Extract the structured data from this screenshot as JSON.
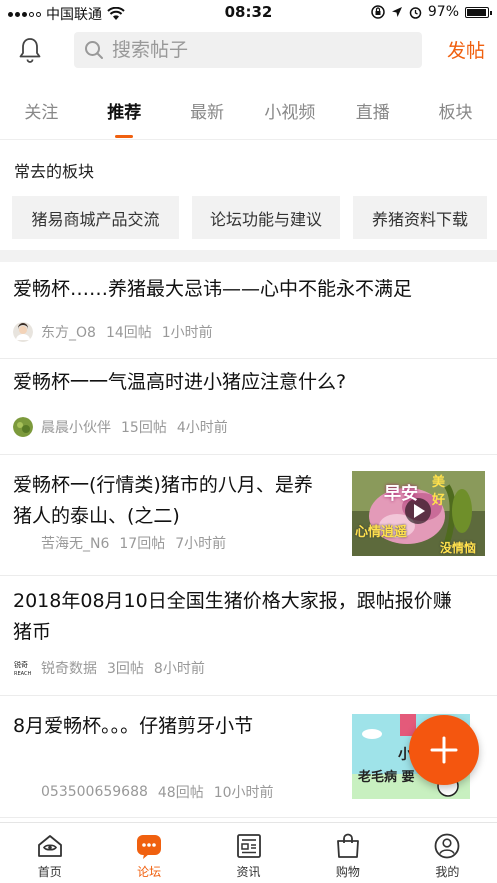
{
  "status_bar": {
    "carrier": "中国联通",
    "time": "08:32",
    "battery": "97%",
    "battery_level": 0.97
  },
  "header": {
    "search_placeholder": "搜索帖子",
    "post_button": "发帖",
    "icons": [
      "bell-icon",
      "search-icon"
    ]
  },
  "tabs": [
    {
      "label": "关注",
      "active": false
    },
    {
      "label": "推荐",
      "active": true
    },
    {
      "label": "最新",
      "active": false
    },
    {
      "label": "小视频",
      "active": false
    },
    {
      "label": "直播",
      "active": false
    },
    {
      "label": "板块",
      "active": false
    }
  ],
  "frequent": {
    "title": "常去的板块",
    "boards": [
      "猪易商城产品交流",
      "论坛功能与建议",
      "养猪资料下载"
    ]
  },
  "posts": [
    {
      "title_lines": [
        "爱畅杯……养猪最大忌讳——心中不能永不满足"
      ],
      "author": "东方_O8",
      "replies": "14回帖",
      "time": "1小时前",
      "has_thumb": false
    },
    {
      "title_lines": [
        "爱畅杯一一气温高时进小猪应注意什么?"
      ],
      "author": "晨晨小伙伴",
      "replies": "15回帖",
      "time": "4小时前",
      "has_thumb": false
    },
    {
      "title_lines": [
        "爱畅杯一(行情类)猪市的八月、是养",
        "猪人的泰山、(之二)"
      ],
      "author": "苦海无_N6",
      "replies": "17回帖",
      "time": "7小时前",
      "has_thumb": true,
      "thumb_text": [
        "早安",
        "美",
        "好",
        "心情逍遥",
        "没情恼"
      ]
    },
    {
      "title_lines": [
        "2018年08月10日全国生猪价格大家报，跟帖报价赚",
        "猪币"
      ],
      "author": "锐奇数据",
      "replies": "3回帖",
      "time": "8小时前",
      "has_thumb": false
    },
    {
      "title_lines": [
        "8月爱畅杯。。。仔猪剪牙小节"
      ],
      "author": "053500659688",
      "replies": "48回帖",
      "time": "10小时前",
      "has_thumb": true,
      "thumb_text": [
        "小闲",
        "老毛病 要"
      ]
    }
  ],
  "bottom_nav": [
    {
      "label": "首页",
      "icon": "home-eye-icon",
      "active": false
    },
    {
      "label": "论坛",
      "icon": "forum-chat-icon",
      "active": true
    },
    {
      "label": "资讯",
      "icon": "news-icon",
      "active": false
    },
    {
      "label": "购物",
      "icon": "shopping-bag-icon",
      "active": false
    },
    {
      "label": "我的",
      "icon": "profile-icon",
      "active": false
    }
  ],
  "colors": {
    "accent": "#f0600f",
    "fab": "#f4560f"
  }
}
